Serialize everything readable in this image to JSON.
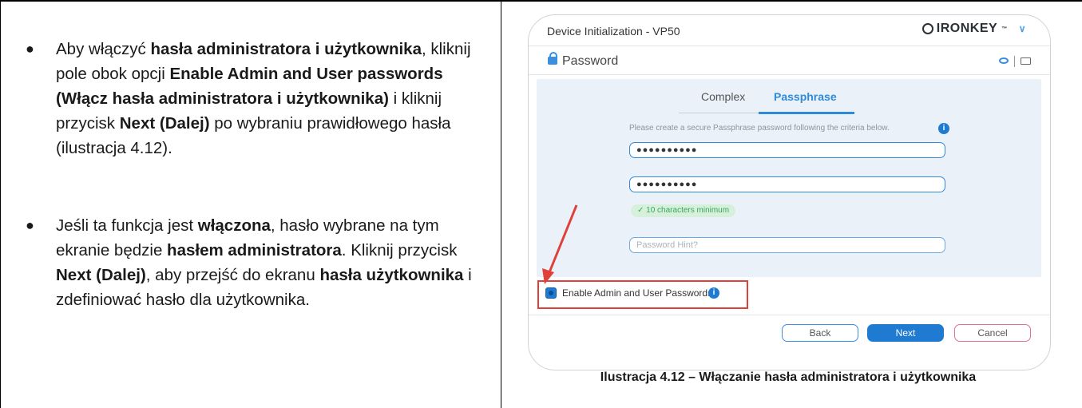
{
  "left_column": {
    "bullet1": {
      "t1": "Aby włączyć ",
      "b1": "hasła administratora i użytkownika",
      "t2": ", kliknij pole obok opcji ",
      "b2": "Enable Admin and User passwords (Włącz hasła administratora i użytkownika)",
      "t3": " i kliknij przycisk ",
      "b3": "Next (Dalej)",
      "t4": " po wybraniu prawidłowego hasła (ilustracja 4.12)."
    },
    "bullet2": {
      "t1": "Jeśli ta funkcja jest ",
      "b1": "włączona",
      "t2": ", hasło wybrane na tym ekranie będzie ",
      "b2": "hasłem administratora",
      "t3": ". Kliknij przycisk ",
      "b3": "Next (Dalej)",
      "t4": ", aby przejść do ekranu ",
      "b4": "hasła użytkownika",
      "t5": " i zdefiniować hasło dla użytkownika."
    }
  },
  "screenshot": {
    "window_title": "Device Initialization - VP50",
    "brand": "IRONKEY",
    "brand_tm": "™",
    "section_title": "Password",
    "tabs": [
      "Complex",
      "Passphrase"
    ],
    "active_tab": "Passphrase",
    "instructions": "Please create a secure Passphrase password following the criteria below.",
    "password_value": "●●●●●●●●●●",
    "confirm_value": "●●●●●●●●●●",
    "criteria_chip": "✓ 10 characters minimum",
    "hint_placeholder": "Password Hint?",
    "enable_label": "Enable Admin and User Passwords",
    "enable_checked": true,
    "buttons": {
      "back": "Back",
      "next": "Next",
      "cancel": "Cancel"
    },
    "accent_color": "#1f7bd2",
    "annotation_color": "#e0403a"
  },
  "caption": "Ilustracja 4.12 – Włączanie hasła administratora i użytkownika"
}
